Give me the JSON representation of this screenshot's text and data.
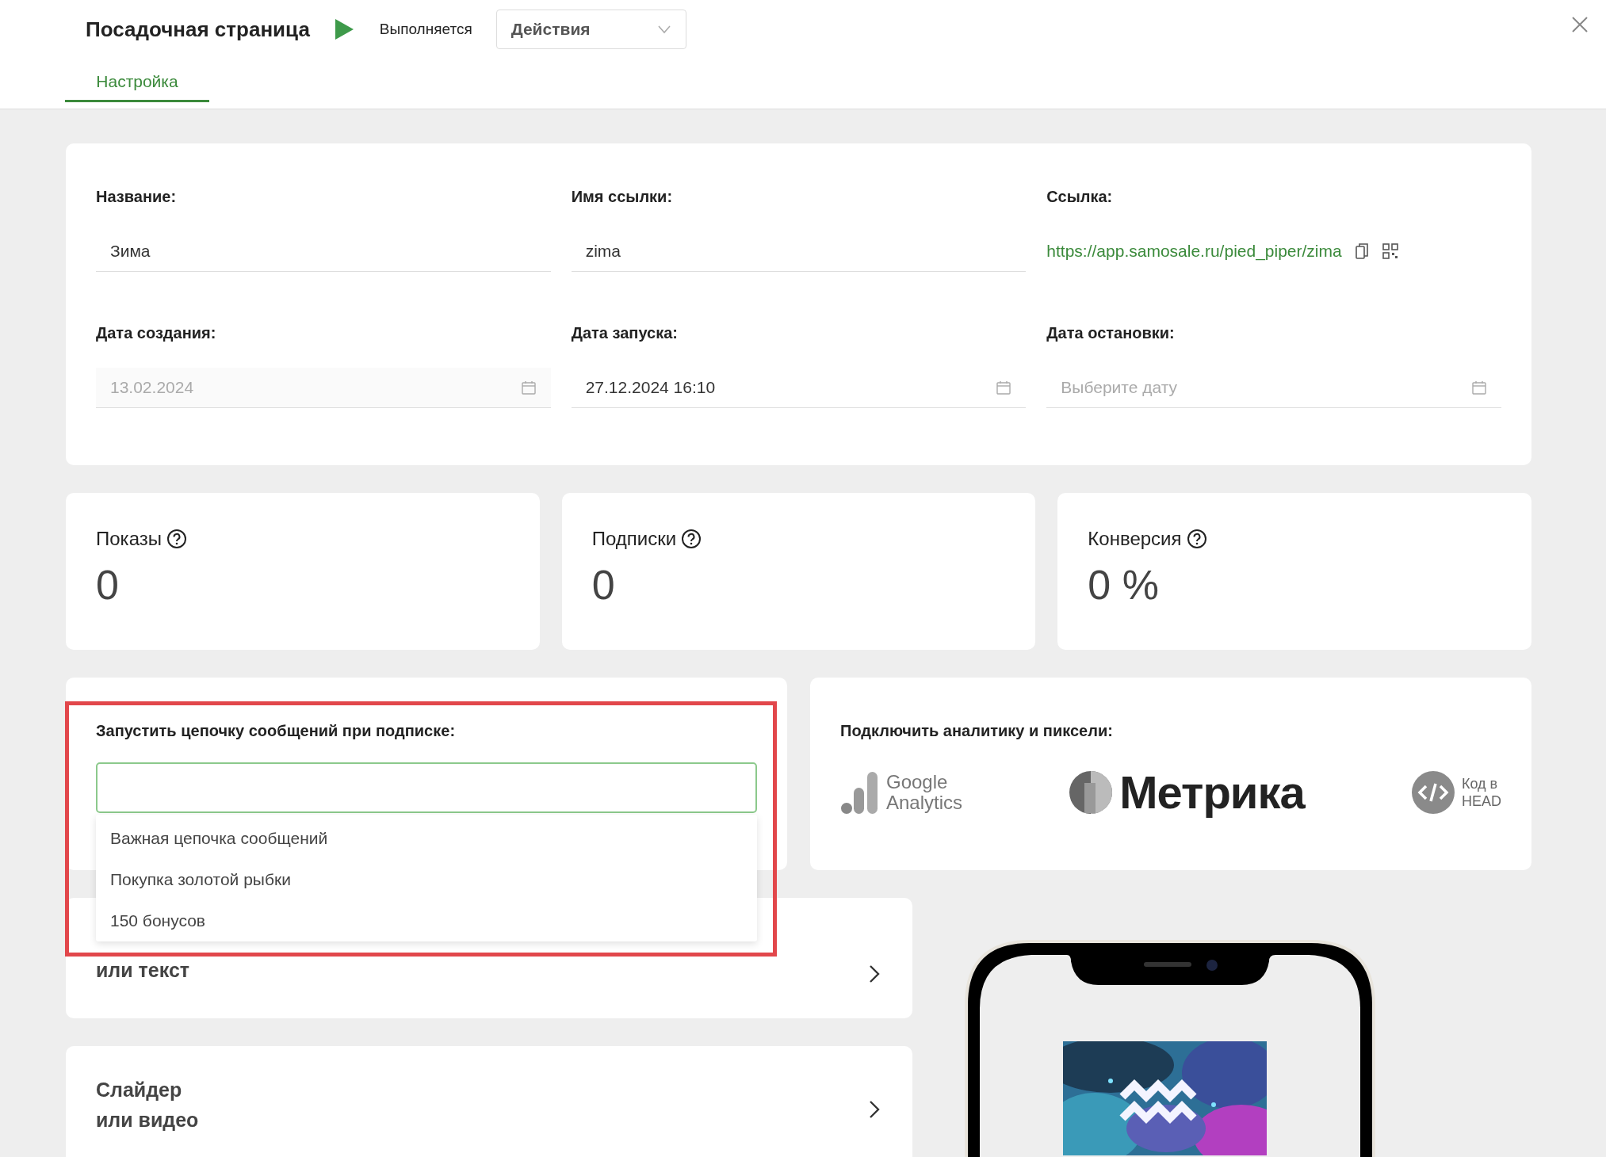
{
  "header": {
    "title": "Посадочная страница",
    "running": true,
    "status": "Выполняется",
    "actions": "Действия"
  },
  "tabs": [
    {
      "label": "Настройка",
      "selected": true
    }
  ],
  "fields": [
    {
      "kind": "text",
      "label": "Название:",
      "value": "Зима"
    },
    {
      "kind": "text",
      "label": "Имя ссылки:",
      "value": "zima"
    },
    {
      "kind": "link",
      "label": "Ссылка:",
      "value": "https://app.samosale.ru/pied_piper/zima"
    },
    {
      "kind": "date",
      "label": "Дата создания:",
      "value": "13.02.2024",
      "disabled": true
    },
    {
      "kind": "date",
      "label": "Дата запуска:",
      "value": "27.12.2024 16:10",
      "disabled": false
    },
    {
      "kind": "date",
      "label": "Дата остановки:",
      "placeholder": "Выберите дату",
      "disabled": false
    }
  ],
  "stats": [
    {
      "label": "Показы",
      "value": "0"
    },
    {
      "label": "Подписки",
      "value": "0"
    },
    {
      "label": "Конверсия",
      "value": "0 %"
    }
  ],
  "subscription_chain": {
    "label": "Запустить цепочку сообщений при подписке:",
    "focused": true,
    "options": [
      "Важная цепочка сообщений",
      "Покупка золотой рыбки",
      "150 бонусов"
    ]
  },
  "analytics": {
    "label": "Подключить аналитику и пиксели:",
    "integrations": [
      {
        "kind": "google",
        "lines": [
          "Google",
          "Analytics"
        ]
      },
      {
        "kind": "metrika",
        "lines": [
          "Метрика"
        ]
      },
      {
        "kind": "head",
        "lines": [
          "Код в",
          "HEAD"
        ]
      }
    ]
  },
  "sections": [
    {
      "title": "или текст"
    },
    {
      "title": "Слайдер\nили видео"
    }
  ]
}
